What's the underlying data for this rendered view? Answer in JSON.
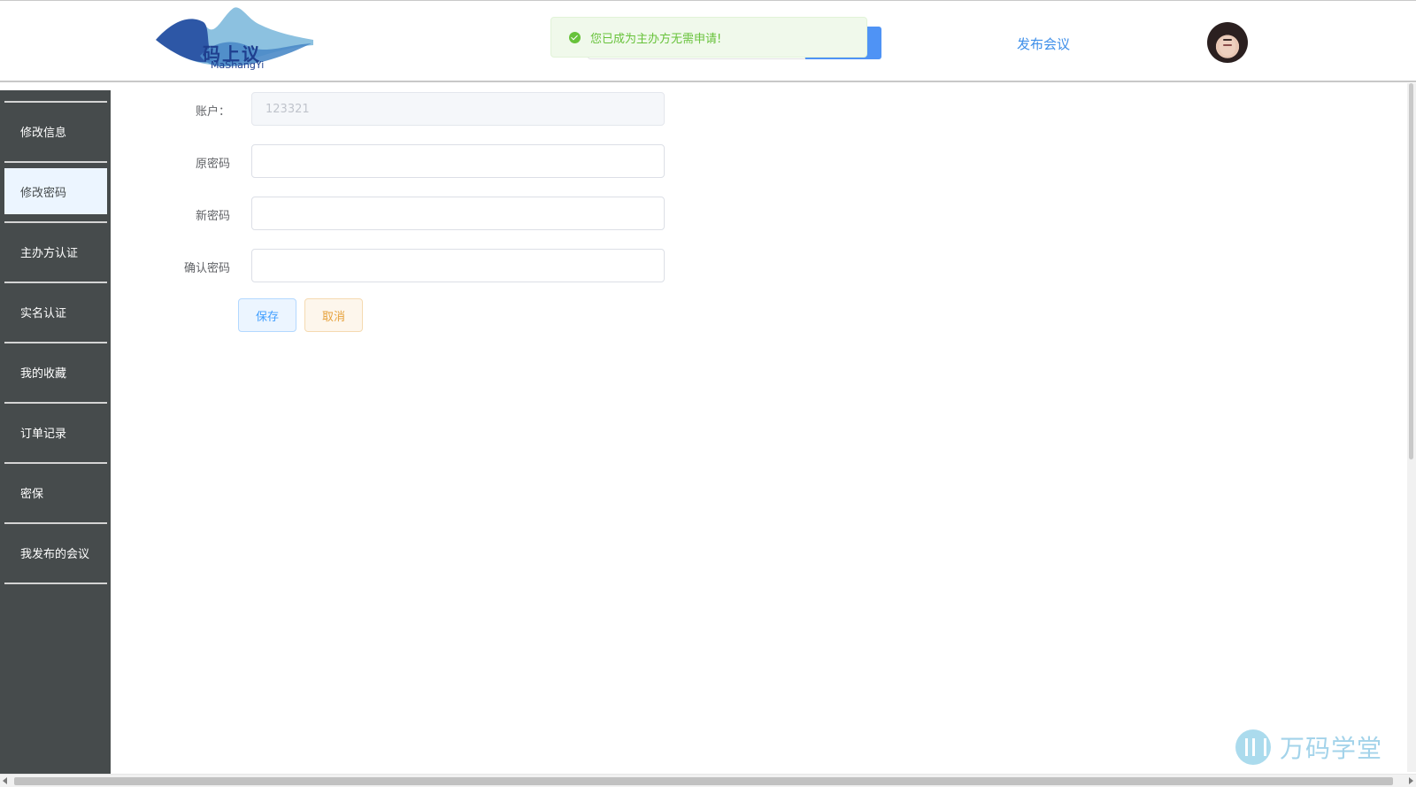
{
  "header": {
    "logo_cn": "码上议",
    "logo_en": "MaShangYi",
    "toast_message": "您已成为主办方无需申请!",
    "publish_link": "发布会议"
  },
  "sidebar": {
    "items": [
      {
        "label": "修改信息",
        "active": false
      },
      {
        "label": "修改密码",
        "active": true
      },
      {
        "label": "主办方认证",
        "active": false
      },
      {
        "label": "实名认证",
        "active": false
      },
      {
        "label": "我的收藏",
        "active": false
      },
      {
        "label": "订单记录",
        "active": false
      },
      {
        "label": "密保",
        "active": false
      },
      {
        "label": "我发布的会议",
        "active": false
      }
    ]
  },
  "form": {
    "account_label": "账户：",
    "account_value": "123321",
    "old_password_label": "原密码",
    "new_password_label": "新密码",
    "confirm_password_label": "确认密码",
    "save_label": "保存",
    "cancel_label": "取消"
  },
  "watermark": {
    "text": "万码学堂"
  },
  "colors": {
    "sidebar_bg": "#464b4c",
    "active_item_bg": "#ecf5ff",
    "toast_green": "#67c23a",
    "link_blue": "#3d8ee9"
  }
}
